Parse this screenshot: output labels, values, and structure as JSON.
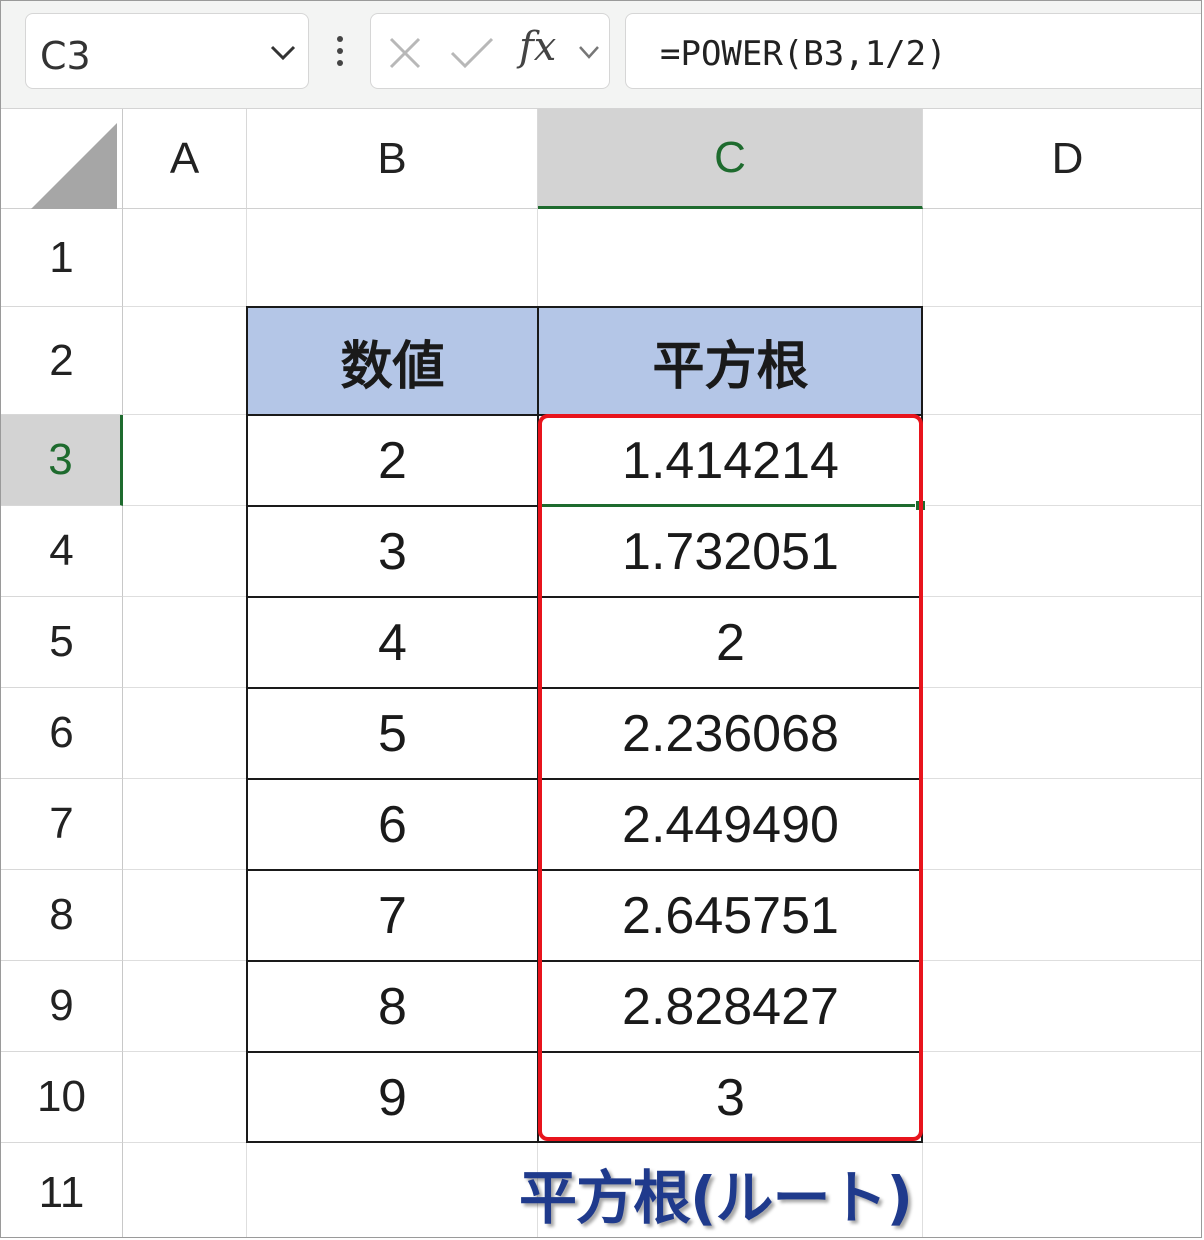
{
  "formula_bar": {
    "name_box": "C3",
    "fx_label": "fx",
    "formula": "=POWER(B3,1/2)"
  },
  "columns": [
    "A",
    "B",
    "C",
    "D"
  ],
  "rows": [
    "1",
    "2",
    "3",
    "4",
    "5",
    "6",
    "7",
    "8",
    "9",
    "10",
    "11"
  ],
  "selection": {
    "cell": "C3",
    "column": "C",
    "row": "3"
  },
  "table": {
    "headers": [
      "数値",
      "平方根"
    ],
    "rows": [
      [
        "2",
        "1.414214"
      ],
      [
        "3",
        "1.732051"
      ],
      [
        "4",
        "2"
      ],
      [
        "5",
        "2.236068"
      ],
      [
        "6",
        "2.449490"
      ],
      [
        "7",
        "2.645751"
      ],
      [
        "8",
        "2.828427"
      ],
      [
        "9",
        "3"
      ]
    ]
  },
  "caption": "平方根(ルート)",
  "colors": {
    "header_fill": "#b4c6e7",
    "highlight_border": "#e8141c",
    "caption_text": "#1f3a8c",
    "selection_accent": "#1e6b2e"
  }
}
